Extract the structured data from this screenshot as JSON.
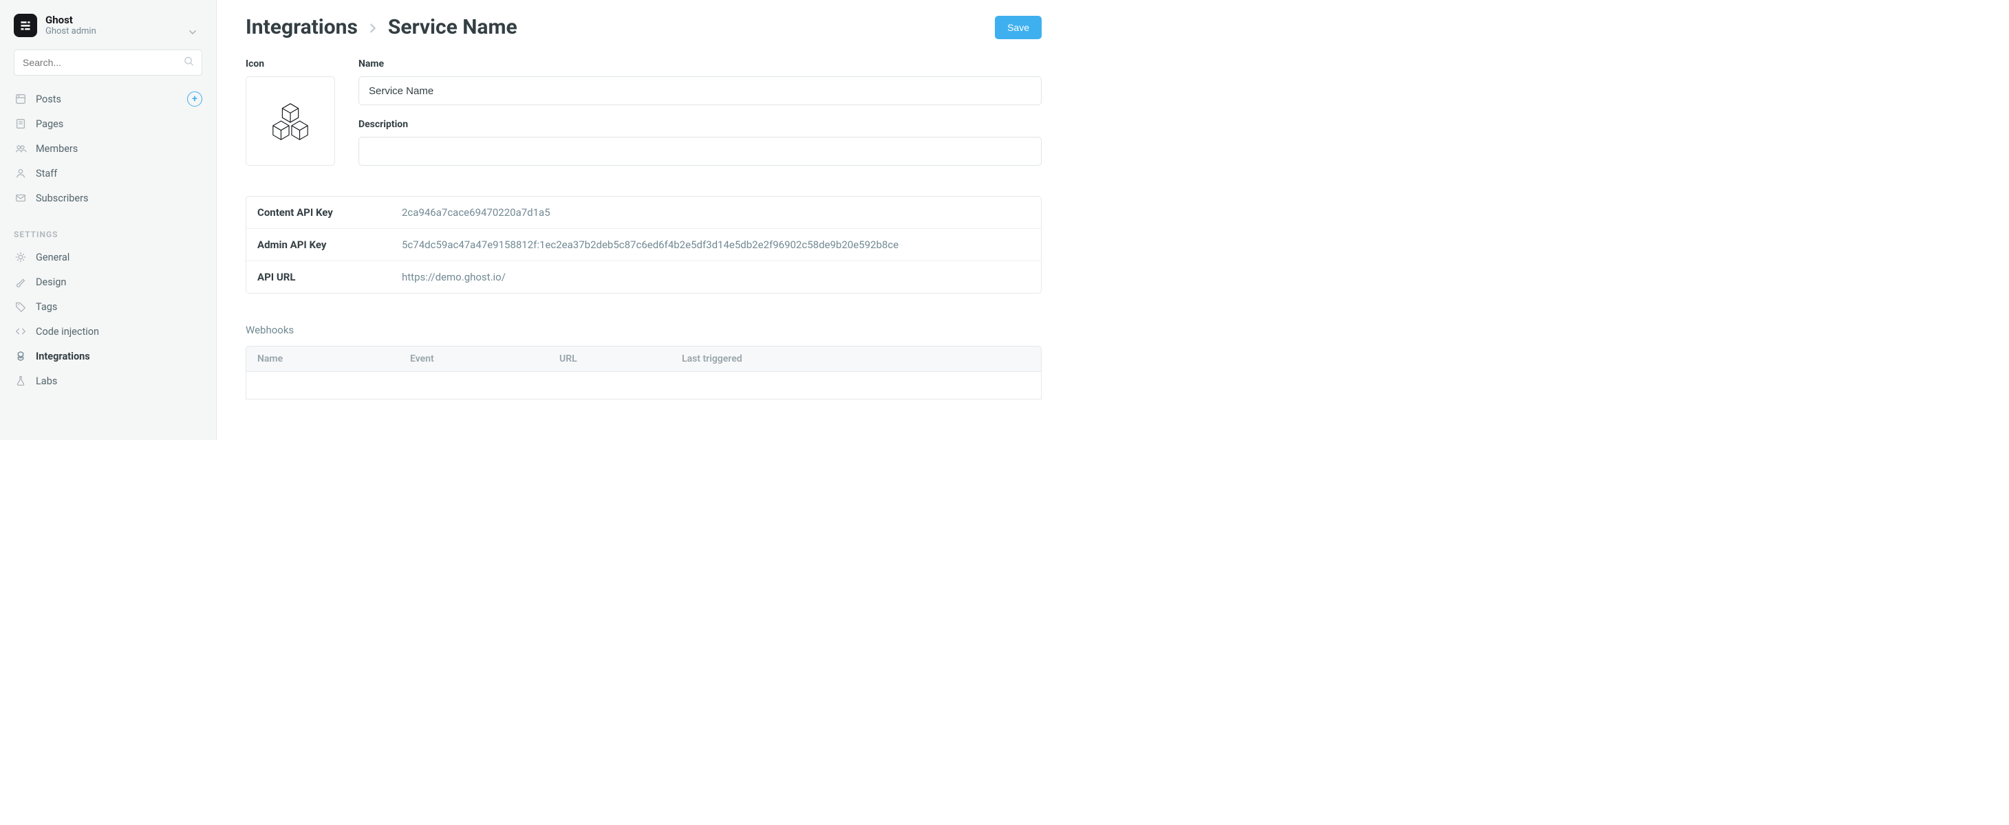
{
  "brand": {
    "name": "Ghost",
    "subtitle": "Ghost admin"
  },
  "search": {
    "placeholder": "Search..."
  },
  "nav": {
    "main": [
      {
        "label": "Posts"
      },
      {
        "label": "Pages"
      },
      {
        "label": "Members"
      },
      {
        "label": "Staff"
      },
      {
        "label": "Subscribers"
      }
    ],
    "settings_label": "SETTINGS",
    "settings": [
      {
        "label": "General"
      },
      {
        "label": "Design"
      },
      {
        "label": "Tags"
      },
      {
        "label": "Code injection"
      },
      {
        "label": "Integrations"
      },
      {
        "label": "Labs"
      }
    ]
  },
  "breadcrumb": {
    "root": "Integrations",
    "current": "Service Name"
  },
  "buttons": {
    "save": "Save"
  },
  "form": {
    "icon_label": "Icon",
    "name_label": "Name",
    "name_value": "Service Name",
    "desc_label": "Description",
    "desc_value": ""
  },
  "api": {
    "rows": [
      {
        "label": "Content API Key",
        "value": "2ca946a7cace69470220a7d1a5"
      },
      {
        "label": "Admin API Key",
        "value": "5c74dc59ac47a47e9158812f:1ec2ea37b2deb5c87c6ed6f4b2e5df3d14e5db2e2f96902c58de9b20e592b8ce"
      },
      {
        "label": "API URL",
        "value": "https://demo.ghost.io/"
      }
    ]
  },
  "webhooks": {
    "title": "Webhooks",
    "columns": {
      "name": "Name",
      "event": "Event",
      "url": "URL",
      "last": "Last triggered"
    }
  }
}
